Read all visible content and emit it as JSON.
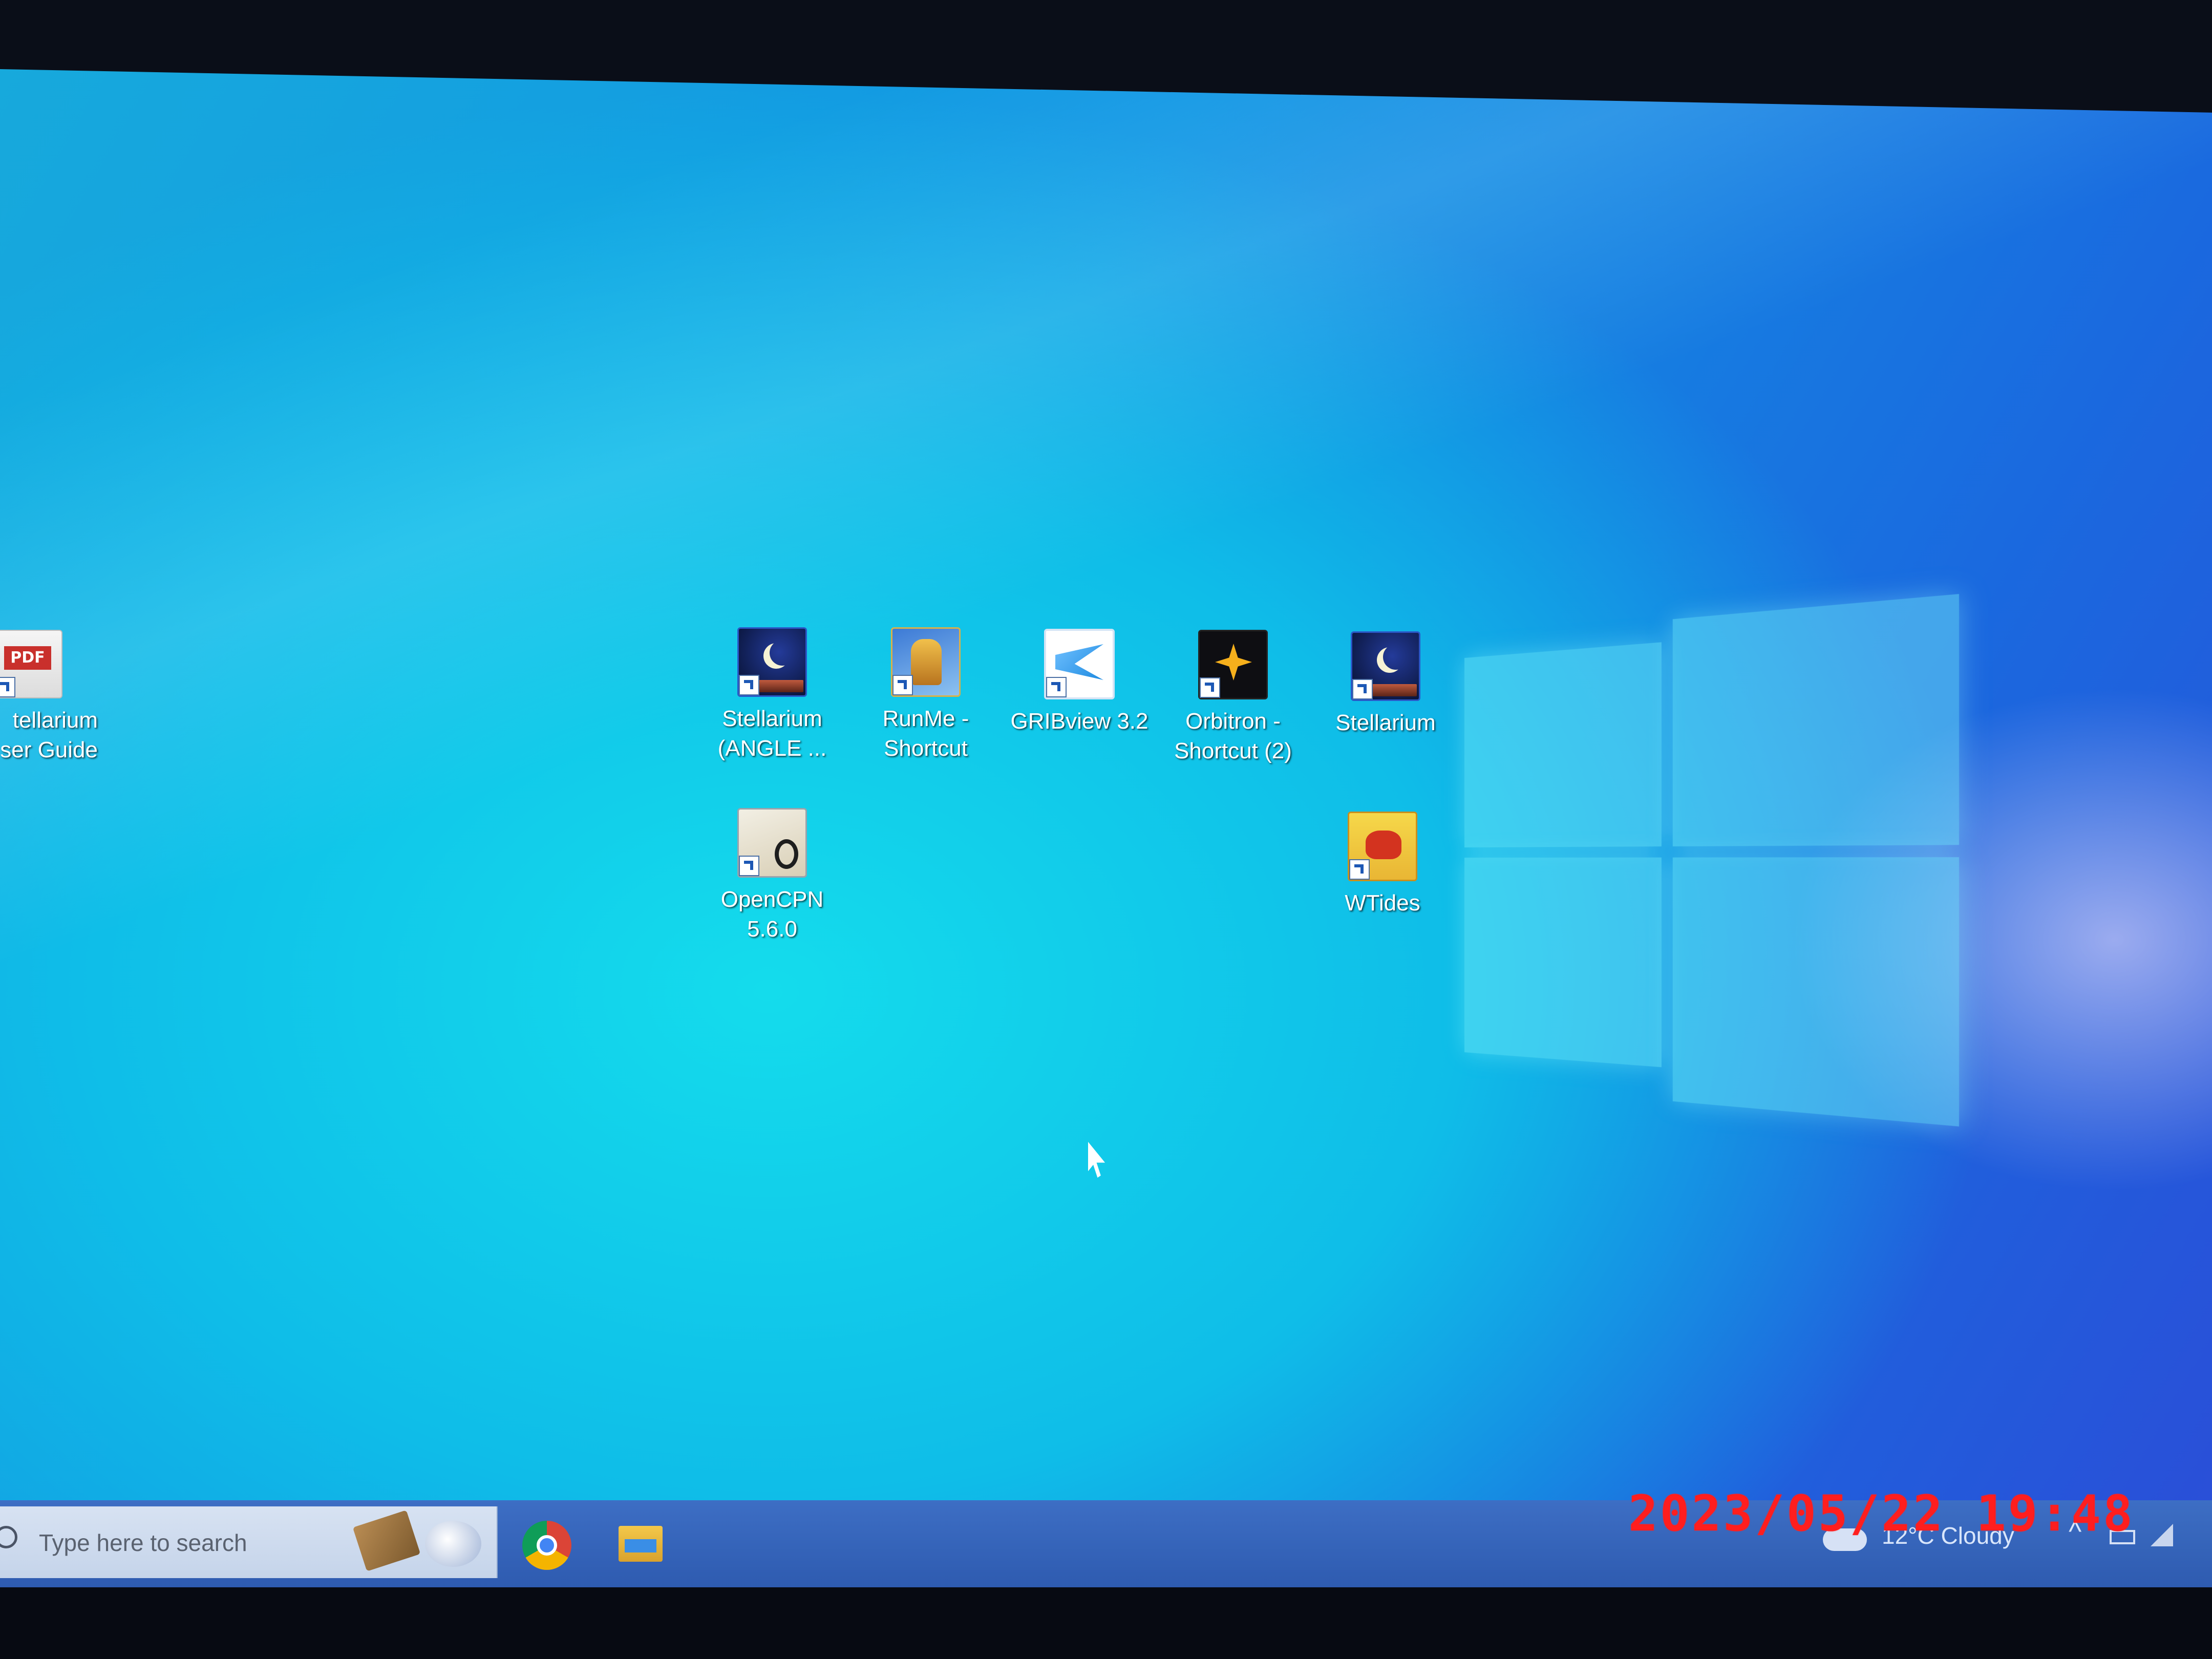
{
  "desktop": {
    "icons": [
      {
        "name": "Stellarium (ANGLE ...",
        "line1": "Stellarium",
        "line2": "(ANGLE ..."
      },
      {
        "name": "RunMe - Shortcut",
        "line1": "RunMe -",
        "line2": "Shortcut"
      },
      {
        "name": "GRIBview 3.2",
        "line1": "GRIBview 3.2",
        "line2": ""
      },
      {
        "name": "Orbitron - Shortcut (2)",
        "line1": "Orbitron -",
        "line2": "Shortcut (2)"
      },
      {
        "name": "Stellarium",
        "line1": "Stellarium",
        "line2": ""
      },
      {
        "name": "OpenCPN 5.6.0",
        "line1": "OpenCPN",
        "line2": "5.6.0"
      },
      {
        "name": "WTides",
        "line1": "WTides",
        "line2": ""
      },
      {
        "name": "Stellarium User Guide",
        "line1": "tellarium",
        "line2": "ser Guide",
        "badge": "PDF"
      }
    ]
  },
  "taskbar": {
    "search_placeholder": "Type here to search",
    "weather": "12°C  Cloudy",
    "chevron": "^"
  },
  "overlay": {
    "timestamp": "2023/05/22 19:48"
  },
  "colors": {
    "wallpaper_accent": "#14dcec",
    "taskbar": "#3d6ec4",
    "timestamp": "#ff1e1e"
  }
}
